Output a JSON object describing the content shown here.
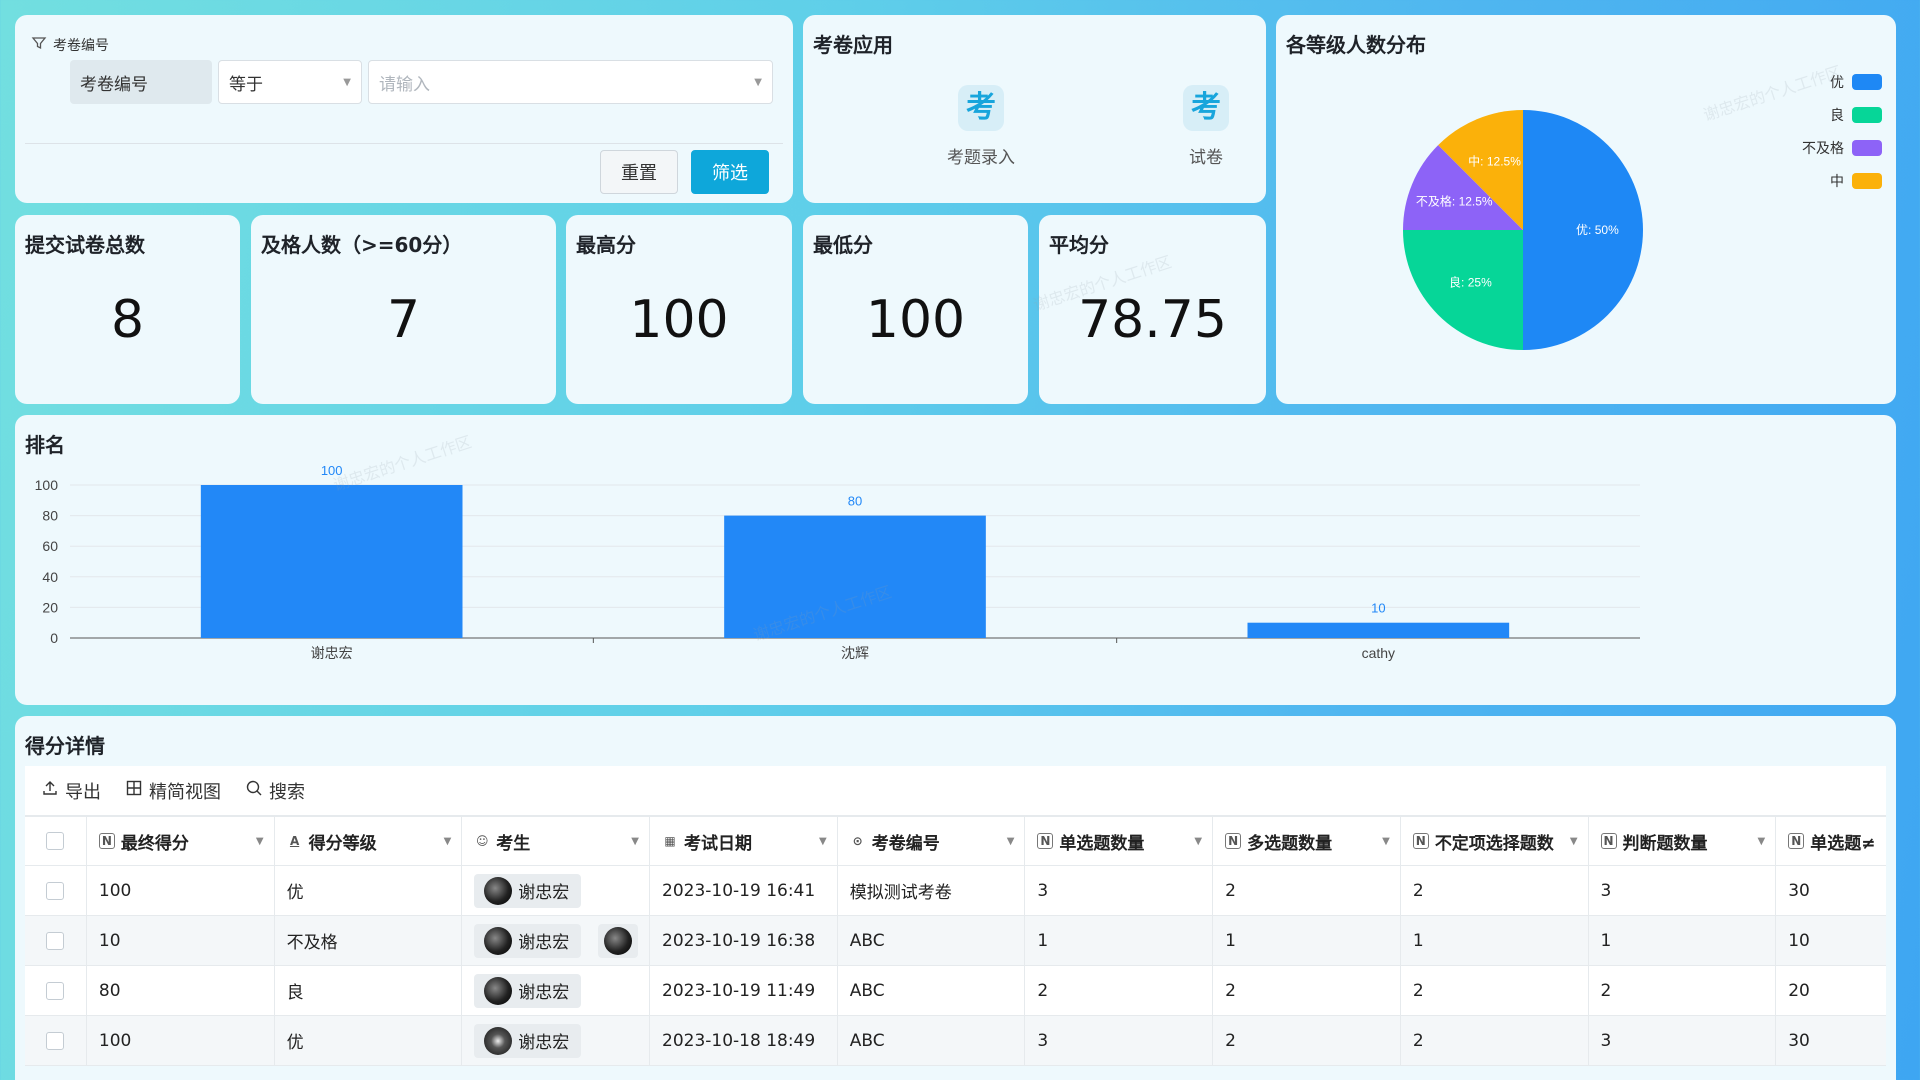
{
  "filter": {
    "title": "考卷编号",
    "field": "考卷编号",
    "operator": "等于",
    "value_placeholder": "请输入",
    "reset_label": "重置",
    "submit_label": "筛选"
  },
  "apps": {
    "title": "考卷应用",
    "items": [
      {
        "icon_char": "考",
        "label": "考题录入"
      },
      {
        "icon_char": "考",
        "label": "试卷"
      }
    ]
  },
  "stats": [
    {
      "label": "提交试卷总数",
      "value": "8"
    },
    {
      "label": "及格人数（>=60分）",
      "value": "7"
    },
    {
      "label": "最高分",
      "value": "100"
    },
    {
      "label": "最低分",
      "value": "100"
    },
    {
      "label": "平均分",
      "value": "78.75"
    }
  ],
  "pie": {
    "title": "各等级人数分布",
    "chart_data": {
      "type": "pie",
      "slices": [
        {
          "name": "优",
          "value": 50,
          "label": "优: 50%",
          "color": "#1e88f5"
        },
        {
          "name": "良",
          "value": 25,
          "label": "良: 25%",
          "color": "#06d698"
        },
        {
          "name": "不及格",
          "value": 12.5,
          "label": "不及格: 12.5%",
          "color": "#8d63f7"
        },
        {
          "name": "中",
          "value": 12.5,
          "label": "中: 12.5%",
          "color": "#fbb10a"
        }
      ],
      "legend": "top-right"
    }
  },
  "rank": {
    "title": "排名",
    "chart_data": {
      "type": "bar",
      "categories": [
        "谢忠宏",
        "沈辉",
        "cathy"
      ],
      "values": [
        100,
        80,
        10
      ],
      "ylim": [
        0,
        100
      ],
      "yticks": [
        0,
        20,
        40,
        60,
        80,
        100
      ],
      "color": "#2288f7",
      "grid": true
    }
  },
  "table": {
    "title": "得分详情",
    "toolbar": {
      "export": "导出",
      "compact": "精简视图",
      "search": "搜索"
    },
    "columns": [
      {
        "icon": "N",
        "label": "最终得分"
      },
      {
        "icon": "A",
        "label": "得分等级"
      },
      {
        "icon": "user",
        "label": "考生"
      },
      {
        "icon": "cal",
        "label": "考试日期"
      },
      {
        "icon": "link",
        "label": "考卷编号"
      },
      {
        "icon": "N",
        "label": "单选题数量"
      },
      {
        "icon": "N",
        "label": "多选题数量"
      },
      {
        "icon": "N",
        "label": "不定项选择题数"
      },
      {
        "icon": "N",
        "label": "判断题数量"
      },
      {
        "icon": "N",
        "label": "单选题≠"
      }
    ],
    "rows": [
      {
        "score": "100",
        "grade": "优",
        "student": "谢忠宏",
        "date": "2023-10-19 16:41",
        "paper": "模拟测试考卷",
        "single": "3",
        "multi": "2",
        "indef": "2",
        "judge": "3",
        "single_score": "30"
      },
      {
        "score": "10",
        "grade": "不及格",
        "student": "谢忠宏",
        "date": "2023-10-19 16:38",
        "paper": "ABC",
        "single": "1",
        "multi": "1",
        "indef": "1",
        "judge": "1",
        "single_score": "10"
      },
      {
        "score": "80",
        "grade": "良",
        "student": "谢忠宏",
        "date": "2023-10-19 11:49",
        "paper": "ABC",
        "single": "2",
        "multi": "2",
        "indef": "2",
        "judge": "2",
        "single_score": "20"
      },
      {
        "score": "100",
        "grade": "优",
        "student": "谢忠宏",
        "date": "2023-10-18 18:49",
        "paper": "ABC",
        "single": "3",
        "multi": "2",
        "indef": "2",
        "judge": "3",
        "single_score": "30"
      }
    ]
  }
}
